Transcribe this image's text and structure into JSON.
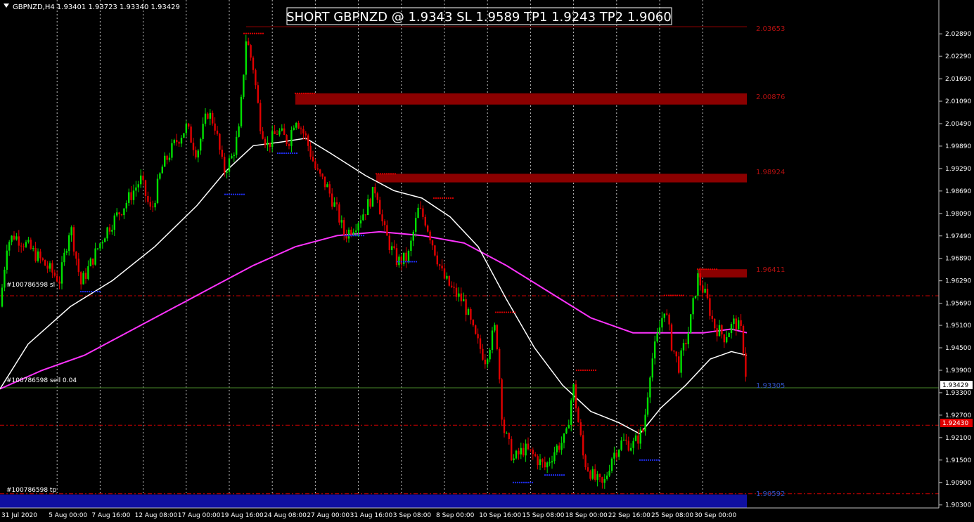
{
  "symbol_header": "GBPNZD,H4  1.93401 1.93723 1.93340 1.93429",
  "headline": "SHORT GBPNZD @ 1.9343 SL 1.9589 TP1 1.9243 TP2 1.9060",
  "colors": {
    "background": "#000000",
    "bull": "#00e000",
    "bear": "#e00000",
    "ma_fast": "#ffffff",
    "ma_slow": "#ff33ff",
    "zone_supply": "#8b0000",
    "zone_demand": "#1010a0",
    "grid": "#c0c0c0",
    "current_price_line": "#4a8a2a",
    "sl_tp_line": "#cc0000"
  },
  "price_axis": {
    "ticks": [
      "2.02890",
      "2.02290",
      "2.01690",
      "2.01090",
      "2.00490",
      "1.99890",
      "1.99290",
      "1.98690",
      "1.98090",
      "1.97490",
      "1.96890",
      "1.96290",
      "1.95690",
      "1.95100",
      "1.94500",
      "1.93900",
      "1.93300",
      "1.92700",
      "1.92100",
      "1.91500",
      "1.90900",
      "1.90300"
    ],
    "current_price_label": "1.93429",
    "tp_price_label": "1.92430"
  },
  "time_axis": {
    "labels": [
      "31 Jul 2020",
      "5 Aug 00:00",
      "7 Aug 16:00",
      "12 Aug 08:00",
      "17 Aug 00:00",
      "19 Aug 16:00",
      "24 Aug 08:00",
      "27 Aug 00:00",
      "31 Aug 16:00",
      "3 Sep 08:00",
      "8 Sep 00:00",
      "10 Sep 16:00",
      "15 Sep 08:00",
      "18 Sep 00:00",
      "22 Sep 16:00",
      "25 Sep 08:00",
      "30 Sep 00:00"
    ]
  },
  "levels": {
    "zone_label_1": "2.03653",
    "zone_label_2": "2.00876",
    "zone_label_3": "1.98924",
    "zone_label_4": "1.96411",
    "zone_label_5": "1.90592",
    "current_label": "1.93305"
  },
  "order_labels": {
    "sl": "#100786598 sl",
    "sell": "#100786598 sell 0.04",
    "tp": "#100786598 tp"
  },
  "chart_data": {
    "type": "candlestick",
    "title": "GBPNZD,H4",
    "ylim": [
      1.9022,
      2.0355
    ],
    "trade": {
      "direction": "SHORT",
      "entry": 1.9343,
      "sl": 1.9589,
      "tp1": 1.9243,
      "tp2": 1.906
    },
    "price_path": [
      [
        0,
        1.956
      ],
      [
        10,
        1.973
      ],
      [
        20,
        1.975
      ],
      [
        35,
        1.973
      ],
      [
        50,
        1.97
      ],
      [
        70,
        1.966
      ],
      [
        85,
        1.963
      ],
      [
        100,
        1.978
      ],
      [
        115,
        1.962
      ],
      [
        130,
        1.968
      ],
      [
        150,
        1.976
      ],
      [
        165,
        1.98
      ],
      [
        180,
        1.984
      ],
      [
        200,
        1.99
      ],
      [
        215,
        1.981
      ],
      [
        230,
        1.993
      ],
      [
        250,
        2.0
      ],
      [
        265,
        2.004
      ],
      [
        280,
        1.997
      ],
      [
        295,
        2.008
      ],
      [
        305,
        2.005
      ],
      [
        318,
        1.992
      ],
      [
        330,
        1.996
      ],
      [
        340,
        2.003
      ],
      [
        350,
        2.028
      ],
      [
        360,
        2.02
      ],
      [
        370,
        2.005
      ],
      [
        380,
        1.999
      ],
      [
        395,
        2.003
      ],
      [
        410,
        2.0
      ],
      [
        420,
        2.007
      ],
      [
        435,
        2.001
      ],
      [
        450,
        1.992
      ],
      [
        465,
        1.988
      ],
      [
        480,
        1.981
      ],
      [
        490,
        1.975
      ],
      [
        505,
        1.978
      ],
      [
        520,
        1.982
      ],
      [
        535,
        1.988
      ],
      [
        545,
        1.977
      ],
      [
        555,
        1.972
      ],
      [
        565,
        1.968
      ],
      [
        580,
        1.969
      ],
      [
        595,
        1.982
      ],
      [
        605,
        1.979
      ],
      [
        615,
        1.973
      ],
      [
        630,
        1.964
      ],
      [
        645,
        1.96
      ],
      [
        660,
        1.957
      ],
      [
        675,
        1.948
      ],
      [
        690,
        1.942
      ],
      [
        705,
        1.951
      ],
      [
        715,
        1.924
      ],
      [
        730,
        1.915
      ],
      [
        745,
        1.918
      ],
      [
        760,
        1.916
      ],
      [
        775,
        1.913
      ],
      [
        790,
        1.918
      ],
      [
        805,
        1.921
      ],
      [
        815,
        1.935
      ],
      [
        830,
        1.915
      ],
      [
        845,
        1.91
      ],
      [
        858,
        1.908
      ],
      [
        870,
        1.916
      ],
      [
        885,
        1.92
      ],
      [
        900,
        1.919
      ],
      [
        915,
        1.923
      ],
      [
        925,
        1.94
      ],
      [
        935,
        1.948
      ],
      [
        945,
        1.956
      ],
      [
        955,
        1.946
      ],
      [
        965,
        1.94
      ],
      [
        980,
        1.95
      ],
      [
        992,
        1.964
      ],
      [
        1005,
        1.958
      ],
      [
        1015,
        1.951
      ],
      [
        1030,
        1.948
      ],
      [
        1045,
        1.952
      ],
      [
        1055,
        1.949
      ],
      [
        1063,
        1.933
      ]
    ],
    "ma_fast": [
      [
        0,
        1.934
      ],
      [
        40,
        1.946
      ],
      [
        100,
        1.956
      ],
      [
        160,
        1.963
      ],
      [
        220,
        1.972
      ],
      [
        280,
        1.983
      ],
      [
        320,
        1.992
      ],
      [
        360,
        1.999
      ],
      [
        400,
        2.0
      ],
      [
        435,
        2.001
      ],
      [
        470,
        1.997
      ],
      [
        520,
        1.991
      ],
      [
        560,
        1.987
      ],
      [
        600,
        1.985
      ],
      [
        640,
        1.98
      ],
      [
        680,
        1.972
      ],
      [
        720,
        1.958
      ],
      [
        760,
        1.945
      ],
      [
        800,
        1.935
      ],
      [
        840,
        1.928
      ],
      [
        880,
        1.925
      ],
      [
        910,
        1.922
      ],
      [
        940,
        1.929
      ],
      [
        975,
        1.935
      ],
      [
        1010,
        1.942
      ],
      [
        1040,
        1.944
      ],
      [
        1062,
        1.943
      ]
    ],
    "ma_slow": [
      [
        0,
        1.934
      ],
      [
        60,
        1.939
      ],
      [
        120,
        1.943
      ],
      [
        180,
        1.949
      ],
      [
        240,
        1.955
      ],
      [
        300,
        1.961
      ],
      [
        360,
        1.967
      ],
      [
        420,
        1.972
      ],
      [
        480,
        1.975
      ],
      [
        540,
        1.976
      ],
      [
        600,
        1.975
      ],
      [
        660,
        1.973
      ],
      [
        720,
        1.967
      ],
      [
        780,
        1.96
      ],
      [
        840,
        1.953
      ],
      [
        900,
        1.949
      ],
      [
        950,
        1.949
      ],
      [
        1000,
        1.949
      ],
      [
        1040,
        1.95
      ],
      [
        1062,
        1.949
      ]
    ],
    "supply_zones": [
      {
        "from_x": 420,
        "price_top": 2.013,
        "price_bottom": 2.01
      },
      {
        "from_x": 535,
        "price_top": 1.9915,
        "price_bottom": 1.9892
      },
      {
        "from_x": 992,
        "price_top": 1.966,
        "price_bottom": 1.9638
      }
    ],
    "demand_zones": [
      {
        "from_x": 0,
        "price_top": 1.9058,
        "price_bottom": 1.9022
      }
    ]
  }
}
